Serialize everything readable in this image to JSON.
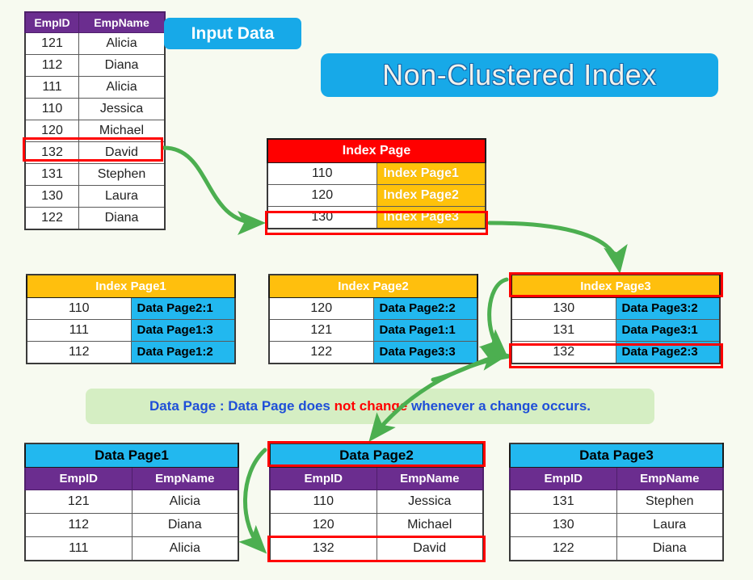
{
  "title": "Non-Clustered Index",
  "input_badge": "Input Data",
  "colors": {
    "background": "#f7faf0",
    "accent_blue": "#17a9e8",
    "header_purple": "#6b2d8f",
    "root_index_red": "#ff0000",
    "index_orange": "#ffbf0d",
    "pointer_cyan": "#22b8ef",
    "arrow_green": "#4caf50",
    "note_green": "#d5eec3",
    "highlight_red": "#ff0000",
    "note_text_blue": "#1f4fd8"
  },
  "input_table": {
    "name": "Input Data",
    "columns": [
      "EmpID",
      "EmpName"
    ],
    "rows": [
      [
        "121",
        "Alicia"
      ],
      [
        "112",
        "Diana"
      ],
      [
        "111",
        "Alicia"
      ],
      [
        "110",
        "Jessica"
      ],
      [
        "120",
        "Michael"
      ],
      [
        "132",
        "David"
      ],
      [
        "131",
        "Stephen"
      ],
      [
        "130",
        "Laura"
      ],
      [
        "122",
        "Diana"
      ]
    ],
    "highlighted_row_index": 5
  },
  "index_root": {
    "title": "Index Page",
    "rows": [
      [
        "110",
        "Index Page1"
      ],
      [
        "120",
        "Index Page2"
      ],
      [
        "130",
        "Index Page3"
      ]
    ],
    "highlighted_row_index": 2
  },
  "index_pages": [
    {
      "title": "Index Page1",
      "title_highlighted": false,
      "rows": [
        [
          "110",
          "Data Page2:1"
        ],
        [
          "111",
          "Data Page1:3"
        ],
        [
          "112",
          "Data Page1:2"
        ]
      ],
      "highlighted_row_index": -1
    },
    {
      "title": "Index Page2",
      "title_highlighted": false,
      "rows": [
        [
          "120",
          "Data Page2:2"
        ],
        [
          "121",
          "Data Page1:1"
        ],
        [
          "122",
          "Data Page3:3"
        ]
      ],
      "highlighted_row_index": -1
    },
    {
      "title": "Index Page3",
      "title_highlighted": true,
      "rows": [
        [
          "130",
          "Data Page3:2"
        ],
        [
          "131",
          "Data Page3:1"
        ],
        [
          "132",
          "Data Page2:3"
        ]
      ],
      "highlighted_row_index": 2
    }
  ],
  "note": {
    "prefix": "Data Page : Data Page does ",
    "highlight": "not change",
    "suffix": " whenever a change occurs."
  },
  "data_pages": [
    {
      "title": "Data Page1",
      "title_highlighted": false,
      "columns": [
        "EmpID",
        "EmpName"
      ],
      "rows": [
        [
          "121",
          "Alicia"
        ],
        [
          "112",
          "Diana"
        ],
        [
          "111",
          "Alicia"
        ]
      ],
      "highlighted_row_index": -1
    },
    {
      "title": "Data Page2",
      "title_highlighted": true,
      "columns": [
        "EmpID",
        "EmpName"
      ],
      "rows": [
        [
          "110",
          "Jessica"
        ],
        [
          "120",
          "Michael"
        ],
        [
          "132",
          "David"
        ]
      ],
      "highlighted_row_index": 2
    },
    {
      "title": "Data Page3",
      "title_highlighted": false,
      "columns": [
        "EmpID",
        "EmpName"
      ],
      "rows": [
        [
          "131",
          "Stephen"
        ],
        [
          "130",
          "Laura"
        ],
        [
          "122",
          "Diana"
        ]
      ],
      "highlighted_row_index": -1
    }
  ],
  "arrows": [
    {
      "name": "input-row-to-index-root",
      "from": "input table row 132",
      "to": "Index Page row 130"
    },
    {
      "name": "index-root-to-index-page3",
      "from": "Index Page row 130",
      "to": "Index Page3 header"
    },
    {
      "name": "index-page3-header-to-row132",
      "from": "Index Page3 header",
      "to": "Index Page3 row 132"
    },
    {
      "name": "index-page2-to-index-page3-row132",
      "from": "Index Page2 row 122",
      "to": "Index Page3 row 132"
    },
    {
      "name": "index-page3-row132-to-data-page2",
      "from": "Index Page3 row 132",
      "to": "Data Page2 header"
    },
    {
      "name": "data-page2-header-to-row132",
      "from": "Data Page2 header",
      "to": "Data Page2 row 132"
    }
  ]
}
